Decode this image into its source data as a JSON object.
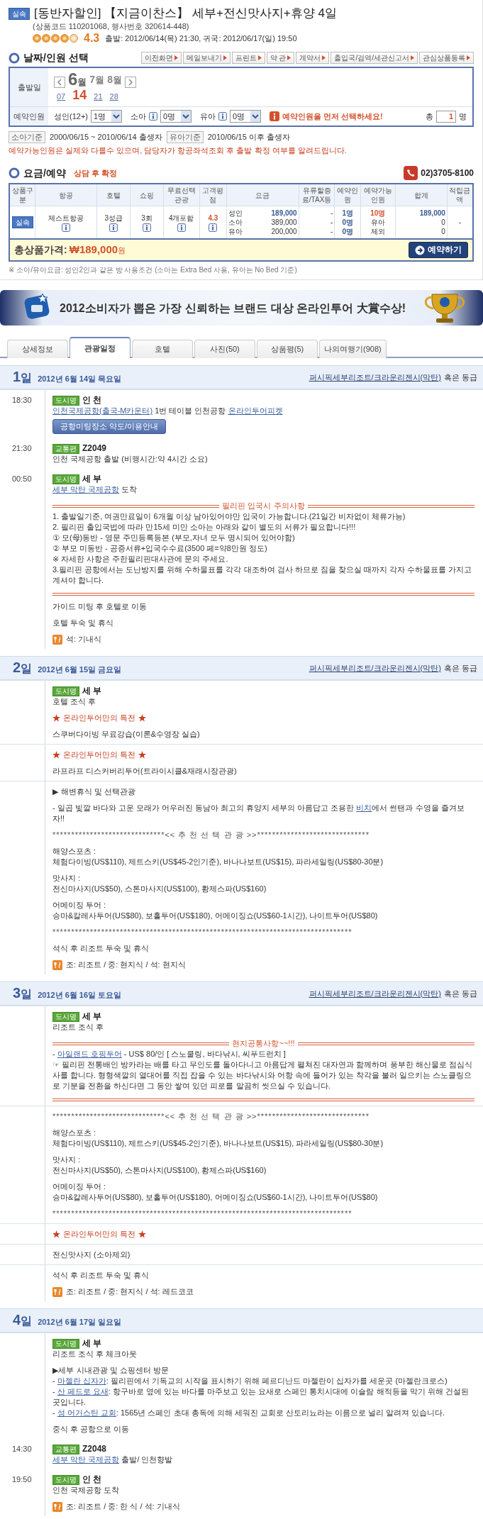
{
  "product": {
    "badge": "실속",
    "title": "[동반자할인] 【지금이찬스】 세부+전신맛사지+휴양 4일",
    "codes": "(상품코드 110201068, 행사번호 320614-448)",
    "stars": 4,
    "rating": "4.3",
    "schedule": "출발: 2012/06/14(목) 21:30, 귀국: 2012/06/17(일) 19:50"
  },
  "date_section": {
    "title": "날짜/인원 선택",
    "actions": [
      "이전화면",
      "메일보내기",
      "프린트",
      "약 관",
      "계약서",
      "출입국/검역/세관신고서",
      "관심상품등록"
    ],
    "departure_label": "출발일",
    "months": [
      {
        "number": "6",
        "unit": "월",
        "selected": true
      },
      {
        "number": "7",
        "unit": "월",
        "selected": false
      },
      {
        "number": "8",
        "unit": "월",
        "selected": false
      }
    ],
    "dates": [
      {
        "label": "07",
        "selected": false
      },
      {
        "label": "14",
        "selected": true
      },
      {
        "label": "21",
        "selected": false
      },
      {
        "label": "28",
        "selected": false
      }
    ],
    "travelers_label": "예약인원",
    "travelers": [
      {
        "label": "성인(12+)",
        "value": "1명",
        "info": false
      },
      {
        "label": "소아",
        "value": "0명",
        "info": true
      },
      {
        "label": "유아",
        "value": "0명",
        "info": true
      }
    ],
    "warning": "예약인원을 먼저 선택하세요!",
    "total_label": "총",
    "total_value": "1",
    "total_unit": "명"
  },
  "age_notes": [
    {
      "tag": "소아기준",
      "text": "2000/06/15 ~ 2010/06/14 출생자"
    },
    {
      "tag": "유아기준",
      "text": "2010/06/15 이후 출생자"
    }
  ],
  "availability_notice": "예약가능인원은 실제와 다를수 있으며, 담당자가 항공좌석조회 후 출발 확정 여부를 알려드립니다.",
  "fare_section": {
    "title": "요금/예약",
    "status": "상담 후 확정",
    "phone": "02)3705-8100",
    "columns": [
      "상품구분",
      "항공",
      "호텔",
      "쇼핑",
      "무료선택관광",
      "고객평점",
      "요금",
      "유류할증료/TAX등",
      "예약인원",
      "예약가능인원",
      "합계",
      "적립금액"
    ],
    "row": {
      "badge": "실속",
      "airline": "제스트항공",
      "hotel": "3성급",
      "shopping": "3회",
      "free_tours": "4개포함",
      "rating": "4.3",
      "points": "-",
      "fares": [
        {
          "label": "성인",
          "amount": "189,000",
          "tax": "-",
          "booked": "1명",
          "available": "10명",
          "total": "189,000"
        },
        {
          "label": "소아",
          "amount": "389,000",
          "tax": "-",
          "booked": "0명",
          "available": "유아",
          "total": "0"
        },
        {
          "label": "유아",
          "amount": "200,000",
          "tax": "-",
          "booked": "0명",
          "available": "제외",
          "total": "0"
        }
      ]
    },
    "total_label": "총상품가격:",
    "total_amount": "₩189,000",
    "total_unit": "원",
    "reserve_button": "예약하기",
    "note": "※ 소아/유아요금: 성인2인과 같은 방 사용조건 (소아는 Extra Bed 사용, 유아는 No Bed 기준)"
  },
  "banner": {
    "text": "2012소비자가 뽑은 가장 신뢰하는 브랜드 대상 온라인투어 大賞수상!"
  },
  "tabs": [
    {
      "label": "상세정보",
      "selected": false
    },
    {
      "label": "관광일정",
      "selected": true
    },
    {
      "label": "호텔",
      "selected": false
    },
    {
      "label": "사진(50)",
      "selected": false
    },
    {
      "label": "상품평(5)",
      "selected": false
    },
    {
      "label": "나의여행기(908)",
      "selected": false
    }
  ],
  "itinerary": [
    {
      "day_number": "1",
      "day_unit": "일",
      "date": "2012년 6월 14일 목요일",
      "hotel": "퍼시픽세부리조트/크라운리젠시(막탄)",
      "hotel_suffix": "혹은 동급",
      "sections": [
        {
          "entries": [
            {
              "time": "18:30",
              "blocks": [
                {
                  "kind": "tag",
                  "badge": "도시명",
                  "name": "인 천",
                  "lines": [
                    [
                      {
                        "text": "인천국제공항(출국-M카운터)",
                        "link": true
                      },
                      " 1번 테이블 인천공항 ",
                      {
                        "text": "온라인투어피켓",
                        "link": true
                      }
                    ]
                  ]
                },
                {
                  "kind": "button",
                  "label": "공항미팅장소 약도/이용안내"
                }
              ]
            },
            {
              "time": "21:30",
              "blocks": [
                {
                  "kind": "tag",
                  "badge": "교통편",
                  "name": "Z2049",
                  "lines": [
                    [
                      "인천 국제공항 출발 (비행시간:약 4시간 소요)"
                    ]
                  ]
                }
              ]
            },
            {
              "time": "00:50",
              "blocks": [
                {
                  "kind": "tag",
                  "badge": "도시명",
                  "name": "세 부",
                  "lines": [
                    [
                      {
                        "text": "세부 막탄 국제공항",
                        "link": true
                      },
                      " 도착"
                    ]
                  ]
                },
                {
                  "kind": "notice",
                  "title": "필리핀 입국시 주의사항",
                  "lines": [
                    [
                      "1. 출발일기준, 여권만료일이 6개월 이상 남아있어야만 입국이 가능합니다.(21일간 비자없이 체류가능)"
                    ],
                    [
                      "2. 필리핀 출입국법에 따라 만15세 미만 소아는 아래와 같이 별도의 서류가 필요합니다!!!"
                    ],
                    [
                      "① 모(母)동반 - 영문 주민등록등본 (부모,자녀 모두 명시되어 있어야함)"
                    ],
                    [
                      "② 부모 미동반 - 공증서류+입국수수료(3500 페=약8만원 정도)"
                    ],
                    [
                      "※ 자세한 사항은 주한필리핀대사관에 문의 주세요."
                    ],
                    [
                      "3.필리핀 공항에서는 도난방지를 위해 수하물표를 각각 대조하여 검사 하므로 짐을 찾으실 때까지 각자 수하물표를 가지고 계셔야 합니다."
                    ]
                  ]
                },
                {
                  "kind": "paragraph",
                  "lines": [
                    [
                      "가이드 미팅 후 호텔로 이동"
                    ]
                  ]
                },
                {
                  "kind": "paragraph",
                  "lines": [
                    [
                      "호텔 투숙 및 휴식"
                    ]
                  ]
                },
                {
                  "kind": "meal",
                  "text": "석: 기내식"
                }
              ]
            }
          ]
        }
      ]
    },
    {
      "day_number": "2",
      "day_unit": "일",
      "date": "2012년 6월 15일 금요일",
      "hotel": "퍼시픽세부리조트/크라운리젠시(막탄)",
      "hotel_suffix": "혹은 동급",
      "sections": [
        {
          "entries": [
            {
              "blocks": [
                {
                  "kind": "tag",
                  "badge": "도시명",
                  "name": "세 부",
                  "lines": [
                    [
                      "호텔 조식 후"
                    ]
                  ]
                },
                {
                  "kind": "special",
                  "text": "온라인투어만의 특전"
                },
                {
                  "kind": "paragraph",
                  "lines": [
                    [
                      "스쿠버다이빙 무료강습(이론&수영장 실습)"
                    ]
                  ]
                }
              ]
            }
          ]
        },
        {
          "entries": [
            {
              "blocks": [
                {
                  "kind": "special",
                  "text": "온라인투어만의 특전"
                },
                {
                  "kind": "paragraph",
                  "lines": [
                    [
                      "라프라프 디스커버리투어(트라이시클&재래시장관광)"
                    ]
                  ]
                }
              ]
            }
          ]
        },
        {
          "entries": [
            {
              "blocks": [
                {
                  "kind": "paragraph",
                  "lines": [
                    [
                      "▶ 해변휴식 및 선택관광"
                    ]
                  ]
                },
                {
                  "kind": "paragraph",
                  "lines": [
                    [
                      "- 일곱 빛깔 바다와 고운 모래가 어우러진 동남아 최고의 휴양지 세부의 아름답고 조용한 ",
                      {
                        "text": "비치",
                        "link": true
                      },
                      "에서 썬탠과 수영을 즐겨보자!!"
                    ]
                  ]
                },
                {
                  "kind": "stars",
                  "text": "******************************<< 추 천 선 택 관 광 >>******************************"
                },
                {
                  "kind": "paragraph",
                  "lines": [
                    [
                      "해양스포츠 :"
                    ],
                    [
                      "체험다이빙(US$110), 제트스키(US$45-2인기준), 바나나보트(US$15), 파라세일링(US$80-30분)"
                    ]
                  ]
                },
                {
                  "kind": "paragraph",
                  "lines": [
                    [
                      "맛사지 :"
                    ],
                    [
                      "전신마사지(US$50), 스톤마사지(US$100), 황제스파(US$160)"
                    ]
                  ]
                },
                {
                  "kind": "paragraph",
                  "lines": [
                    [
                      "어메이징 투어 :"
                    ],
                    [
                      "승마&칼레사투어(US$80), 보홀투어(US$180), 어메이징쇼(US$60-1시간), 나이트투어(US$80)"
                    ]
                  ]
                },
                {
                  "kind": "stars",
                  "text": "********************************************************************************"
                },
                {
                  "kind": "paragraph",
                  "lines": [
                    [
                      "석식 후 리조트 투숙 및 휴식"
                    ]
                  ]
                },
                {
                  "kind": "meal",
                  "text": "조: 리조트 / 중: 현지식 / 석: 현지식"
                }
              ]
            }
          ]
        }
      ]
    },
    {
      "day_number": "3",
      "day_unit": "일",
      "date": "2012년 6월 16일 토요일",
      "hotel": "퍼시픽세부리조트/크라운리젠시(막탄)",
      "hotel_suffix": "혹은 동급",
      "sections": [
        {
          "entries": [
            {
              "blocks": [
                {
                  "kind": "tag",
                  "badge": "도시명",
                  "name": "세 부",
                  "lines": [
                    [
                      "리조트 조식 후"
                    ]
                  ]
                },
                {
                  "kind": "notice",
                  "title": "현지공통사항~~!!!",
                  "lines": [
                    [
                      "- ",
                      {
                        "text": "아일랜드 호핑투어",
                        "link": true
                      },
                      " - US$ 80/인 [ 스노쿨링, 바다낚시, 씨푸드런치 ]"
                    ],
                    [
                      "☞ 필리핀 전통배인 방카라는 배를 타고 무인도를 돌아다니고 아름답게 펼쳐진 대자연과 함께하며 풍부한 해산물로 점심식사를 합니다. 형형색깔의 열대어를 직접 잡을 수 있는 바다낚시와 어항 속에 들어가 있는 착각을 불러 일으키는 스노클링으로 기분을 전환을 하신다면 그 동안 쌓여 있던 피로를 말끔히 씻으실 수 있습니다."
                    ]
                  ]
                }
              ]
            }
          ]
        },
        {
          "entries": [
            {
              "blocks": [
                {
                  "kind": "stars",
                  "text": "******************************<< 추 천 선 택 관 광 >>******************************"
                },
                {
                  "kind": "paragraph",
                  "lines": [
                    [
                      "해양스포츠 :"
                    ],
                    [
                      "체험다이빙(US$110), 제트스키(US$45-2인기준), 바나나보트(US$15), 파라세일링(US$80-30분)"
                    ]
                  ]
                },
                {
                  "kind": "paragraph",
                  "lines": [
                    [
                      "맛사지 :"
                    ],
                    [
                      "전신마사지(US$50), 스톤마사지(US$100), 황제스파(US$160)"
                    ]
                  ]
                },
                {
                  "kind": "paragraph",
                  "lines": [
                    [
                      "어메이징 투어 :"
                    ],
                    [
                      "승마&칼레사투어(US$80), 보홀투어(US$180), 어메이징쇼(US$60-1시간), 나이트투어(US$80)"
                    ]
                  ]
                },
                {
                  "kind": "stars",
                  "text": "********************************************************************************"
                }
              ]
            }
          ]
        },
        {
          "entries": [
            {
              "blocks": [
                {
                  "kind": "special",
                  "text": "온라인투어만의 특전"
                }
              ]
            }
          ]
        },
        {
          "entries": [
            {
              "blocks": [
                {
                  "kind": "paragraph",
                  "lines": [
                    [
                      "전신맛사지 (소아제외)"
                    ]
                  ]
                }
              ]
            }
          ]
        },
        {
          "entries": [
            {
              "blocks": [
                {
                  "kind": "paragraph",
                  "lines": [
                    [
                      "석식 후 리조트 투숙 및 휴식"
                    ]
                  ]
                },
                {
                  "kind": "meal",
                  "text": "조: 리조트 / 중: 현지식 / 석: 레드코코"
                }
              ]
            }
          ]
        }
      ]
    },
    {
      "day_number": "4",
      "day_unit": "일",
      "date": "2012년 6월 17일 일요일",
      "sections": [
        {
          "entries": [
            {
              "blocks": [
                {
                  "kind": "tag",
                  "badge": "도시명",
                  "name": "세 부",
                  "lines": [
                    [
                      "리조트 조식 후 체크아웃"
                    ]
                  ]
                },
                {
                  "kind": "paragraph",
                  "lines": [
                    [
                      "▶세부 시내관광 및 쇼핑센터 방문"
                    ],
                    [
                      "- ",
                      {
                        "text": "마젤란 십자가",
                        "link": true
                      },
                      ": 필리핀에서 기독교의 시작을 표시하기 위해 페르디난드 마젤란이 십자가를 세운곳 (마젤란크로스)"
                    ],
                    [
                      "- ",
                      {
                        "text": "산 페드로 요새",
                        "link": true
                      },
                      ": 항구바로 옆에 있는 바다를 마주보고 있는 요새로 스페인 통치시대에 이슬람 해적등을 막기 위해 건설된 곳입니다."
                    ],
                    [
                      "- ",
                      {
                        "text": "성 어거스틴 교회",
                        "link": true
                      },
                      ": 1565년 스페인 초대 총독에 의해 세워진 교회로 산토리뇨라는 이름으로 널리 알려져 있습니다."
                    ]
                  ]
                },
                {
                  "kind": "paragraph",
                  "lines": [
                    [
                      "중식 후 공항으로 이동"
                    ]
                  ]
                }
              ]
            },
            {
              "time": "14:30",
              "blocks": [
                {
                  "kind": "tag",
                  "badge": "교통편",
                  "name": "Z2048",
                  "lines": [
                    [
                      {
                        "text": "세부 막탄 국제공항",
                        "link": true
                      },
                      " 출발/ 인천향발"
                    ]
                  ]
                }
              ]
            },
            {
              "time": "19:50",
              "blocks": [
                {
                  "kind": "tag",
                  "badge": "도시명",
                  "name": "인 천",
                  "lines": [
                    [
                      "인천 국제공항 도착"
                    ]
                  ]
                },
                {
                  "kind": "meal",
                  "text": "조: 리조트 / 중: 한 식 / 석: 기내식"
                }
              ]
            }
          ]
        }
      ]
    }
  ]
}
